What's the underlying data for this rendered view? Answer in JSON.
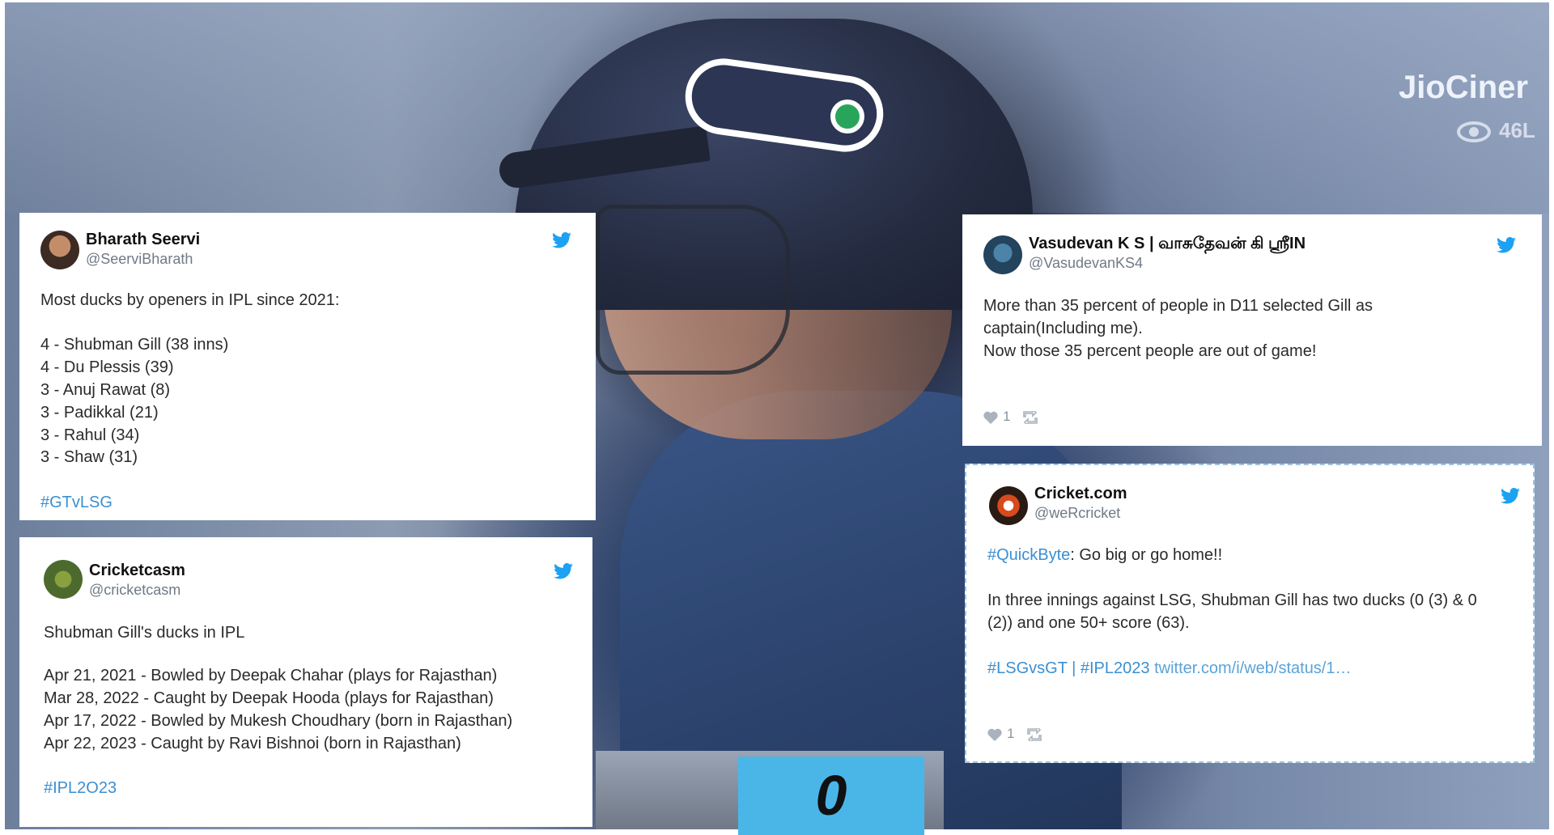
{
  "overlay": {
    "broadcaster": "JioCiner",
    "views": "46L",
    "score": "0"
  },
  "tweets": [
    {
      "name": "Bharath Seervi",
      "handle": "@SeerviBharath",
      "lines": [
        "Most ducks by openers in IPL since 2021:",
        "4 - Shubman Gill (38 inns)",
        "4 - Du Plessis (39)",
        "3 - Anuj Rawat (8)",
        "3 - Padikkal (21)",
        "3 - Rahul (34)",
        "3 - Shaw (31)"
      ],
      "hashtag": "#GTvLSG"
    },
    {
      "name": "Cricketcasm",
      "handle": "@cricketcasm",
      "lines": [
        "Shubman Gill's ducks in IPL",
        "Apr 21, 2021 - Bowled by Deepak Chahar (plays for Rajasthan)",
        "Mar 28, 2022 - Caught by Deepak Hooda (plays for Rajasthan)",
        "Apr 17, 2022 - Bowled by Mukesh Choudhary (born in Rajasthan)",
        "Apr 22, 2023 - Caught by Ravi Bishnoi (born in Rajasthan)"
      ],
      "hashtag": "#IPL2O23"
    },
    {
      "name": "Vasudevan K S | வாசுதேவன் கி ஸ்ரீIN",
      "handle": "@VasudevanKS4",
      "lines": [
        "More than 35 percent of people in D11 selected Gill as",
        "captain(Including me).",
        "Now those 35 percent people are out of game!"
      ],
      "likes": "1"
    },
    {
      "name": "Cricket.com",
      "handle": "@weRcricket",
      "hashtag_inline": "#QuickByte",
      "first_line_rest": ": Go big or go home!!",
      "lines": [
        "In three innings against LSG, Shubman Gill has two ducks (0 (3) & 0",
        "(2)) and one 50+ score (63)."
      ],
      "tag1": "#LSGvsGT",
      "separator": " | ",
      "tag2": "#IPL2023",
      "link": " twitter.com/i/web/status/1…",
      "likes": "1"
    }
  ],
  "colors": {
    "twitter_blue": "#1da1f2",
    "hashtag": "#3b8fd1",
    "score_box": "#4ab6e8"
  },
  "icons": [
    "twitter-bird-icon",
    "heart-icon",
    "retweet-icon",
    "eye-icon"
  ]
}
